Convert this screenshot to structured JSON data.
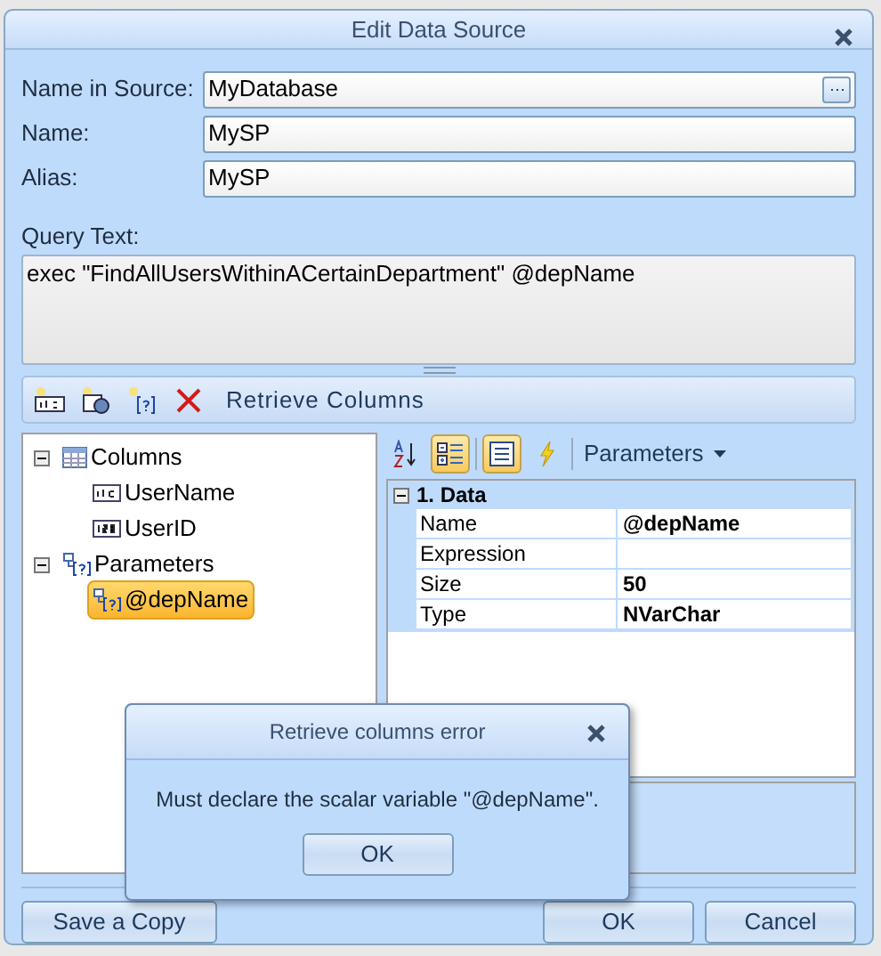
{
  "window": {
    "title": "Edit Data Source"
  },
  "fields": [
    {
      "label": "Name in Source:",
      "value": "MyDatabase",
      "kind": "browse"
    },
    {
      "label": "Name:",
      "value": "MySP",
      "kind": "plain"
    },
    {
      "label": "Alias:",
      "value": "MySP",
      "kind": "plain"
    }
  ],
  "query": {
    "label": "Query Text:",
    "value": "exec \"FindAllUsersWithinACertainDepartment\" @depName"
  },
  "toolbar": {
    "button_label": "Retrieve Columns"
  },
  "tree": [
    {
      "label": "Columns",
      "kind": "columns",
      "expanded": true,
      "selected": false,
      "children": [
        {
          "label": "UserName",
          "kind": "text",
          "selected": false
        },
        {
          "label": "UserID",
          "kind": "number",
          "selected": false
        }
      ]
    },
    {
      "label": "Parameters",
      "kind": "parameter",
      "expanded": true,
      "selected": false,
      "children": [
        {
          "label": "@depName",
          "kind": "parameter",
          "selected": true
        }
      ]
    }
  ],
  "property_toolbar": {
    "buttons": [
      {
        "kind": "sort",
        "selected": false
      },
      {
        "kind": "categorized",
        "selected": true
      },
      {
        "kind": "properties",
        "selected": true
      },
      {
        "kind": "events",
        "selected": false
      }
    ],
    "dropdown": "Parameters"
  },
  "property_grid": {
    "category": "1. Data",
    "expanded": true,
    "rows": [
      {
        "name": "Name",
        "value": "@depName"
      },
      {
        "name": "Expression",
        "value": ""
      },
      {
        "name": "Size",
        "value": "50"
      },
      {
        "name": "Type",
        "value": "NVarChar"
      }
    ]
  },
  "buttons": {
    "save_copy": "Save a Copy",
    "ok": "OK",
    "cancel": "Cancel"
  },
  "error_dialog": {
    "title": "Retrieve columns error",
    "message": "Must declare the scalar variable \"@depName\".",
    "ok": "OK"
  }
}
